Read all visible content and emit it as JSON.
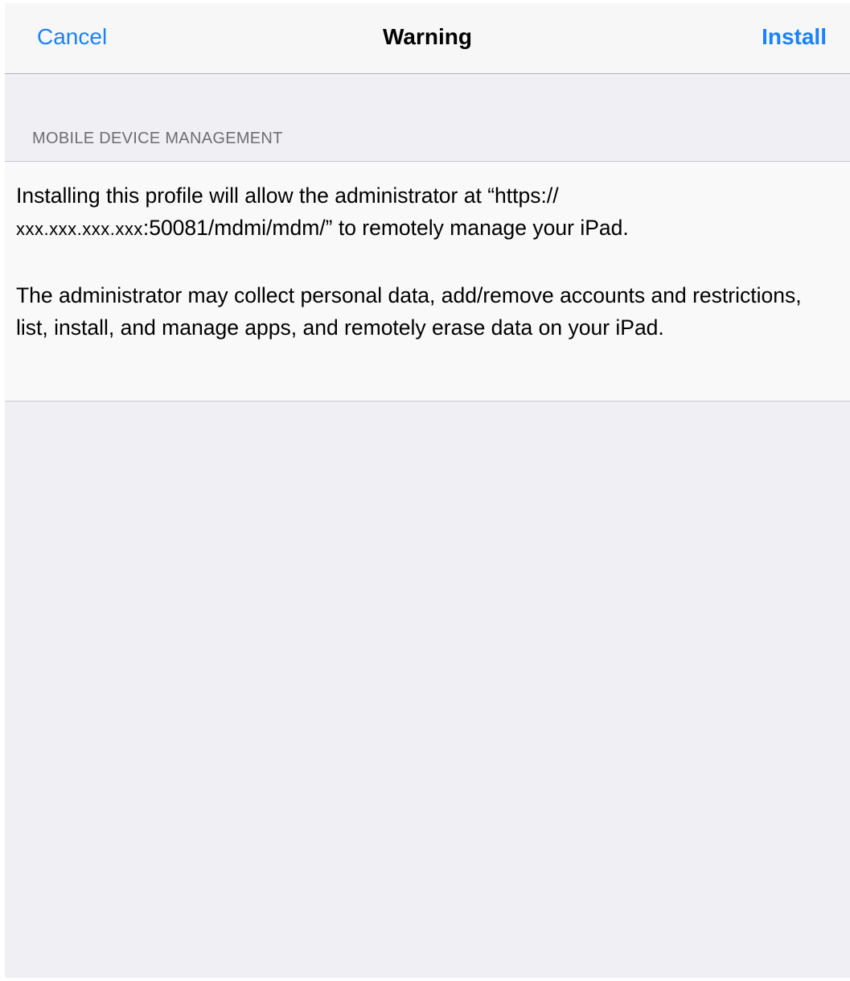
{
  "nav": {
    "cancel_label": "Cancel",
    "title": "Warning",
    "install_label": "Install"
  },
  "section": {
    "header": "MOBILE DEVICE MANAGEMENT"
  },
  "content": {
    "paragraph1_line1": "Installing this profile will allow the administrator at “https://",
    "paragraph1_host": "xxx.xxx.xxx.xxx",
    "paragraph1_line2_rest": ":50081/mdmi/mdm/” to remotely manage your iPad.",
    "paragraph2": "The administrator may collect personal data, add/remove accounts and restrictions, list, install, and manage apps, and remotely erase data on your iPad."
  },
  "colors": {
    "accent": "#1b82f7",
    "background": "#efeff4",
    "nav_background": "#f7f7f7",
    "section_header_text": "#6d6d72"
  }
}
